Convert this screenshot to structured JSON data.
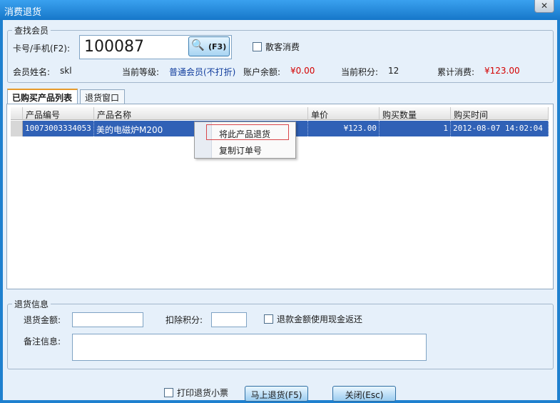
{
  "window": {
    "title": "消费退货",
    "close_icon": "close-icon"
  },
  "member_search": {
    "group_label": "查找会员",
    "card_label": "卡号/手机(F2):",
    "card_value": "100087",
    "search_label": "(F3)",
    "walkin_label": "散客消费",
    "name_label": "会员姓名:",
    "name_value": "skl",
    "level_label": "当前等级:",
    "level_value": "普通会员(不打折)",
    "balance_label": "账户余额:",
    "balance_value": "¥0.00",
    "points_label": "当前积分:",
    "points_value": "12",
    "total_label": "累计消费:",
    "total_value": "¥123.00"
  },
  "tabs": [
    {
      "label": "已购买产品列表"
    },
    {
      "label": "退货窗口"
    }
  ],
  "table": {
    "columns": [
      "产品编号",
      "产品名称",
      "单价",
      "购买数量",
      "购买时间"
    ],
    "rows": [
      {
        "code": "10073003334053",
        "name": "美的电磁炉M200",
        "price": "¥123.00",
        "qty": "1",
        "time": "2012-08-07 14:02:04"
      }
    ]
  },
  "context_menu": {
    "items": [
      "将此产品退货",
      "复制订单号"
    ]
  },
  "return_info": {
    "group_label": "退货信息",
    "amount_label": "退货金额:",
    "points_deduct_label": "扣除积分:",
    "cash_refund_label": "退款金额使用现金返还",
    "remark_label": "备注信息:"
  },
  "footer": {
    "print_label": "打印退货小票",
    "return_button": "马上退货(F5)",
    "close_button": "关闭(Esc)"
  },
  "colors": {
    "title_bar": "#2b8fe0",
    "selection": "#3061b6",
    "accent_red": "#d40000"
  }
}
